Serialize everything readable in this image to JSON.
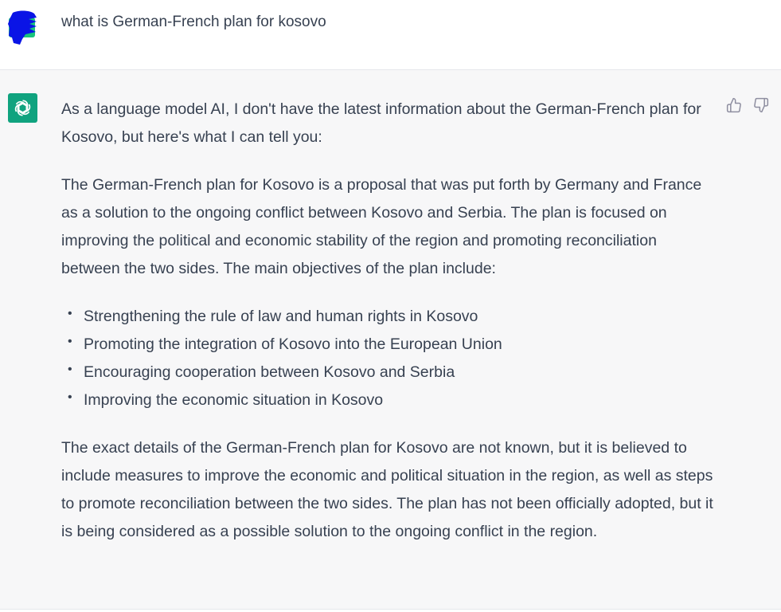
{
  "user_message": {
    "text": "what is German-French plan for kosovo",
    "avatar_icon": "user-avatar-icon"
  },
  "assistant_message": {
    "avatar_icon": "openai-logo-icon",
    "intro": "As a language model AI, I don't have the latest information about the German-French plan for Kosovo, but here's what I can tell you:",
    "paragraph1": "The German-French plan for Kosovo is a proposal that was put forth by Germany and France as a solution to the ongoing conflict between Kosovo and Serbia. The plan is focused on improving the political and economic stability of the region and promoting reconciliation between the two sides. The main objectives of the plan include:",
    "bullets": [
      "Strengthening the rule of law and human rights in Kosovo",
      "Promoting the integration of Kosovo into the European Union",
      "Encouraging cooperation between Kosovo and Serbia",
      "Improving the economic situation in Kosovo"
    ],
    "paragraph2": "The exact details of the German-French plan for Kosovo are not known, but it is believed to include measures to improve the economic and political situation in the region, as well as steps to promote reconciliation between the two sides. The plan has not been officially adopted, but it is being considered as a possible solution to the ongoing conflict in the region.",
    "feedback": {
      "thumbs_up_icon": "thumbs-up-icon",
      "thumbs_down_icon": "thumbs-down-icon"
    }
  },
  "colors": {
    "assistant_bg": "#f7f7f8",
    "assistant_avatar_bg": "#10a37f",
    "text": "#374151",
    "user_avatar_blue": "#0a14e6",
    "user_avatar_green": "#19c37d"
  }
}
